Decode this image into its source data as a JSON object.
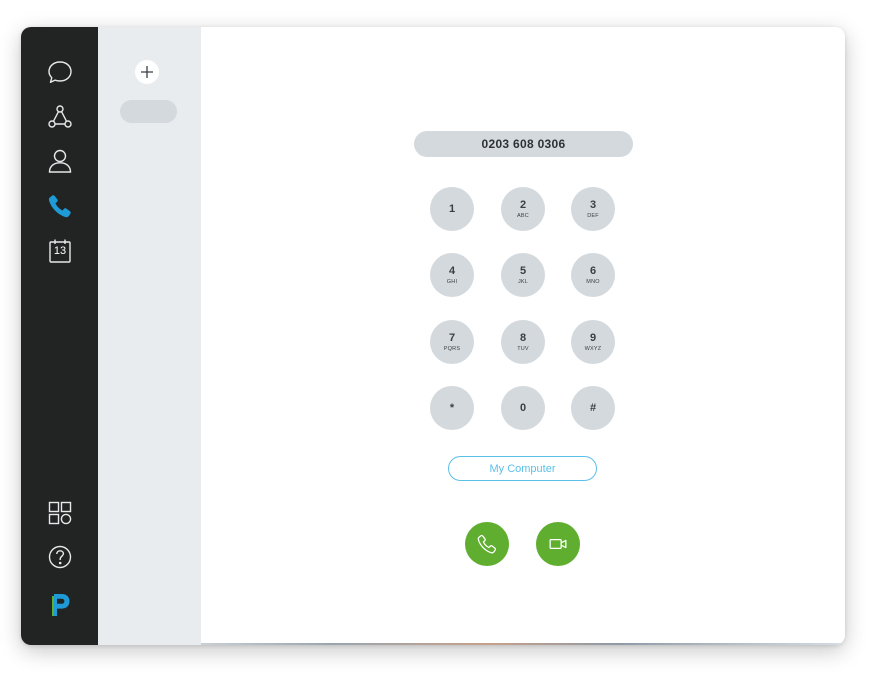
{
  "nav": {
    "items": [
      {
        "name": "chat",
        "icon": "speech-bubble-icon",
        "active": false
      },
      {
        "name": "teams",
        "icon": "network-triangle-icon",
        "active": false
      },
      {
        "name": "contacts",
        "icon": "person-icon",
        "active": false
      },
      {
        "name": "phone",
        "icon": "phone-handset-icon",
        "active": true
      },
      {
        "name": "calendar",
        "icon": "calendar-icon",
        "active": false,
        "day": "13"
      }
    ],
    "bottom": [
      {
        "name": "apps",
        "icon": "apps-grid-icon"
      },
      {
        "name": "help",
        "icon": "question-mark-icon"
      },
      {
        "name": "logo",
        "icon": "p-logo-icon"
      }
    ]
  },
  "panel": {
    "add_icon": "plus-icon"
  },
  "dialer": {
    "number": "0203 608 0306",
    "keys": [
      {
        "digit": "1",
        "letters": ""
      },
      {
        "digit": "2",
        "letters": "ABC"
      },
      {
        "digit": "3",
        "letters": "DEF"
      },
      {
        "digit": "4",
        "letters": "GHI"
      },
      {
        "digit": "5",
        "letters": "JKL"
      },
      {
        "digit": "6",
        "letters": "MNO"
      },
      {
        "digit": "7",
        "letters": "PQRS"
      },
      {
        "digit": "8",
        "letters": "TUV"
      },
      {
        "digit": "9",
        "letters": "WXYZ"
      },
      {
        "digit": "*",
        "letters": ""
      },
      {
        "digit": "0",
        "letters": ""
      },
      {
        "digit": "#",
        "letters": ""
      }
    ],
    "device_label": "My Computer",
    "actions": [
      {
        "name": "voice-call",
        "icon": "phone-handset-icon"
      },
      {
        "name": "video-call",
        "icon": "video-camera-icon"
      }
    ]
  },
  "colors": {
    "rail_bg": "#222424",
    "panel_bg": "#e8ecef",
    "active_icon": "#1e9ad6",
    "call_green": "#5fae2f",
    "device_blue": "#5bc0e8",
    "key_grey": "#d3d9dd",
    "logo_blue": "#1e9ad6",
    "logo_green": "#5fae2f"
  }
}
